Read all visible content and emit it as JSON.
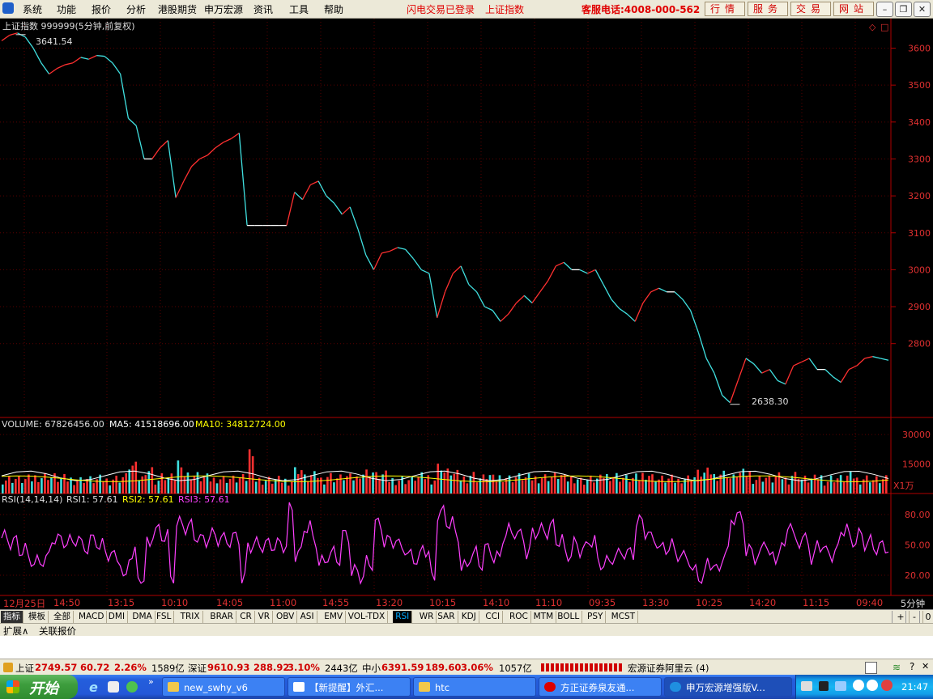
{
  "menubar": {
    "items": [
      "系统",
      "功能",
      "报价",
      "分析",
      "港股期货",
      "申万宏源",
      "资讯",
      "工具",
      "帮助"
    ],
    "status_flash": "闪电交易已登录",
    "status_index": "上证指数",
    "hotline": "客服电话:4008-000-562",
    "buttons": [
      "行情",
      "服务",
      "交易",
      "网站"
    ]
  },
  "chart_header": {
    "title": "上证指数 999999(5分钟,前复权)",
    "high_marker": "3641.54",
    "low_marker": "2638.30"
  },
  "price_axis": [
    "3600",
    "3500",
    "3400",
    "3300",
    "3200",
    "3100",
    "3000",
    "2900",
    "2800"
  ],
  "volume_header": {
    "label": "VOLUME: 67826456.00",
    "ma5": "MA5: 41518696.00",
    "ma10": "MA10: 34812724.00"
  },
  "volume_axis": [
    "30000",
    "15000"
  ],
  "volume_unit": "X1万",
  "rsi_header": {
    "label": "RSI(14,14,14)",
    "rsi1": "RSI1: 57.61",
    "rsi2": "RSI2: 57.61",
    "rsi3": "RSI3: 57.61"
  },
  "rsi_axis": [
    "80.00",
    "50.00",
    "20.00"
  ],
  "time_axis": [
    "12月25日",
    "14:50",
    "13:15",
    "10:10",
    "14:05",
    "11:00",
    "14:55",
    "13:20",
    "10:15",
    "14:10",
    "11:10",
    "09:35",
    "13:30",
    "10:25",
    "14:20",
    "11:15",
    "09:40"
  ],
  "period": "5分钟",
  "indicator_tabs": [
    "指标",
    "模板",
    "全部",
    "MACD",
    "DMI",
    "DMA",
    "FSL",
    "TRIX",
    "BRAR",
    "CR",
    "VR",
    "OBV",
    "ASI",
    "EMV",
    "VOL-TDX",
    "RSI",
    "WR",
    "SAR",
    "KDJ",
    "CCI",
    "ROC",
    "MTM",
    "BOLL",
    "PSY",
    "MCST"
  ],
  "active_tab": "RSI",
  "tab_controls": [
    "+",
    "-",
    "0"
  ],
  "extension_tabs": [
    "扩展∧",
    "关联报价"
  ],
  "statusbar": {
    "sh_label": "上证",
    "sh_value": "2749.57",
    "sh_change": "60.72",
    "sh_pct": "2.26%",
    "sh_amount": "1589亿",
    "sz_label": "深证",
    "sz_value": "9610.93",
    "sz_change": "288.92",
    "sz_pct": "3.10%",
    "sz_amount": "2443亿",
    "zx_label": "中小",
    "zx_value": "6391.59",
    "zx_change": "189.60",
    "zx_pct": "3.06%",
    "zx_amount": "1057亿",
    "server": "宏源证券阿里云 (4)"
  },
  "taskbar": {
    "start": "开始",
    "tasks": [
      "new_swhy_v6",
      "【新提醒】外汇...",
      "htc",
      "方正证券泉友通...",
      "申万宏源增强版V..."
    ],
    "clock": "21:47"
  },
  "chart_data": {
    "type": "line",
    "title": "上证指数 999999(5分钟,前复权)",
    "y_range": [
      2600,
      3680
    ],
    "price_close": [
      3620,
      3635,
      3641,
      3630,
      3600,
      3560,
      3530,
      3545,
      3555,
      3560,
      3575,
      3570,
      3580,
      3578,
      3560,
      3530,
      3410,
      3390,
      3300,
      3300,
      3330,
      3350,
      3195,
      3240,
      3280,
      3300,
      3310,
      3330,
      3345,
      3355,
      3370,
      3120,
      3120,
      3120,
      3120,
      3120,
      3120,
      3210,
      3190,
      3230,
      3240,
      3200,
      3180,
      3150,
      3170,
      3110,
      3040,
      3000,
      3045,
      3050,
      3060,
      3055,
      3030,
      3000,
      2990,
      2870,
      2940,
      2990,
      3010,
      2960,
      2940,
      2900,
      2890,
      2860,
      2880,
      2910,
      2930,
      2910,
      2940,
      2970,
      3010,
      3020,
      3000,
      3000,
      2990,
      3000,
      2960,
      2920,
      2895,
      2880,
      2860,
      2910,
      2940,
      2950,
      2940,
      2940,
      2920,
      2890,
      2830,
      2760,
      2720,
      2660,
      2640,
      2700,
      2760,
      2745,
      2720,
      2730,
      2700,
      2690,
      2740,
      2750,
      2760,
      2730,
      2730,
      2710,
      2695,
      2730,
      2740,
      2760,
      2765,
      2760,
      2755
    ],
    "volume_ma_axis": [
      0,
      35000
    ],
    "rsi_range": [
      0,
      100
    ],
    "rsi_levels": [
      80,
      50,
      20
    ],
    "colors": {
      "up": "#ff3030",
      "down": "#40e0e0",
      "rsi": "#ff40ff",
      "ma5": "#ffffff",
      "ma10": "#ffff00"
    }
  }
}
